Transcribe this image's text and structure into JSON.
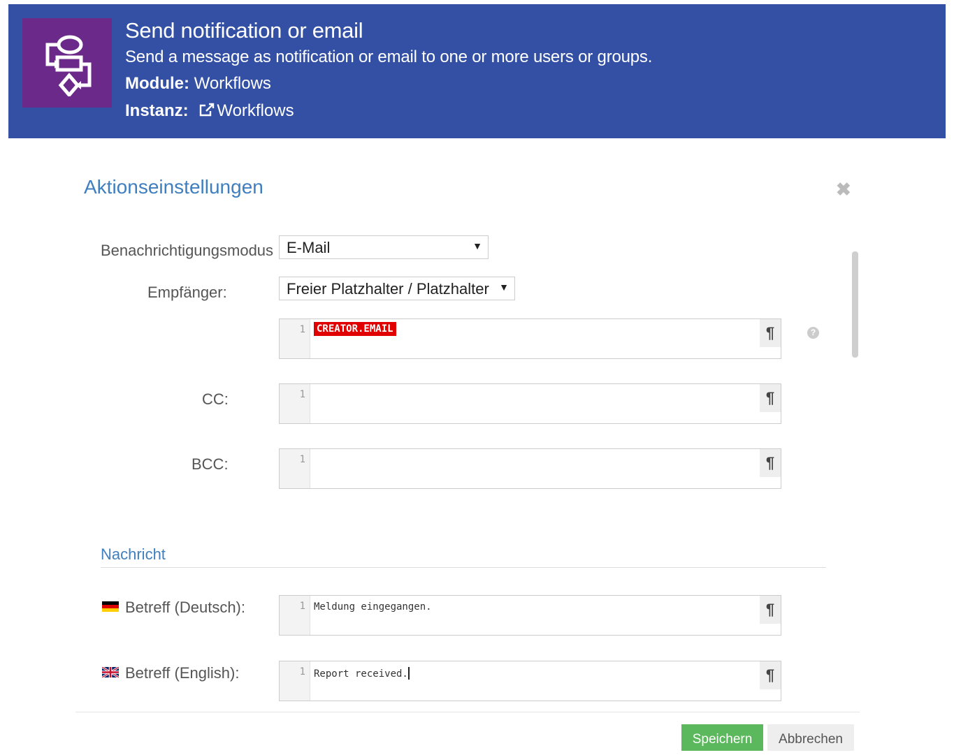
{
  "header": {
    "title": "Send notification or email",
    "description": "Send a message as notification or email to one or more users or groups.",
    "module_label": "Module:",
    "module_value": "Workflows",
    "instance_label": "Instanz:",
    "instance_value": "Workflows",
    "colors": {
      "banner": "#3350a4",
      "logo_bg": "#6b2a8a"
    }
  },
  "dialog": {
    "title": "Aktionseinstellungen",
    "close_icon": "close-icon"
  },
  "form": {
    "mode_label": "Benachrichtigungsmodus",
    "mode_value": "E-Mail",
    "recipient_label": "Empfänger:",
    "recipient_value": "Freier Platzhalter / Platzhalter",
    "recipient_editor": {
      "line": "1",
      "token": "CREATOR.EMAIL"
    },
    "cc_label": "CC:",
    "cc_editor": {
      "line": "1",
      "text": ""
    },
    "bcc_label": "BCC:",
    "bcc_editor": {
      "line": "1",
      "text": ""
    },
    "help_icon": "?"
  },
  "message": {
    "section_title": "Nachricht",
    "subject_de_label": "Betreff (Deutsch):",
    "subject_de_editor": {
      "line": "1",
      "text": "Meldung eingegangen."
    },
    "subject_en_label": "Betreff (English):",
    "subject_en_editor": {
      "line": "1",
      "text": "Report received."
    }
  },
  "editor_toggle": "¶",
  "buttons": {
    "save": "Speichern",
    "cancel": "Abbrechen",
    "save_color": "#5cb85c"
  }
}
